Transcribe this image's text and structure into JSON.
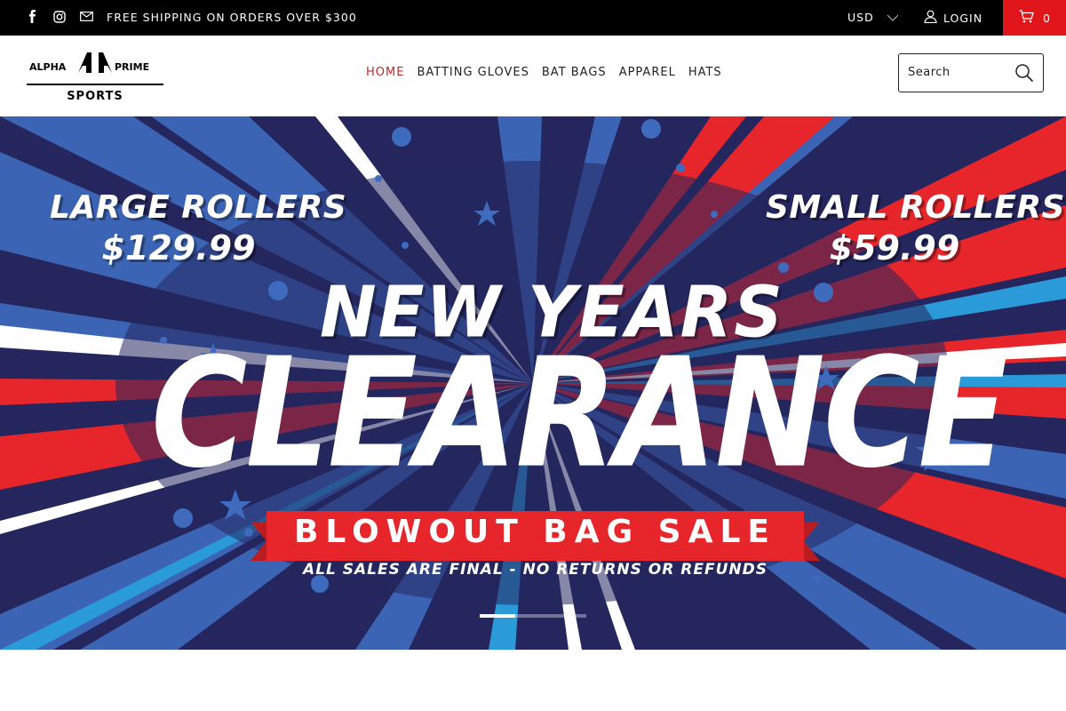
{
  "topbar": {
    "shipping_text": "FREE SHIPPING ON ORDERS OVER $300",
    "currency": "USD",
    "login_label": "LOGIN",
    "cart_count": "0",
    "social_icons": [
      "facebook-icon",
      "instagram-icon",
      "email-icon"
    ]
  },
  "header": {
    "logo": {
      "top_left": "ALPHA",
      "top_right": "PRIME",
      "bottom": "SPORTS"
    },
    "nav": [
      {
        "label": "HOME",
        "active": true
      },
      {
        "label": "BATTING GLOVES",
        "active": false
      },
      {
        "label": "BAT BAGS",
        "active": false
      },
      {
        "label": "APPAREL",
        "active": false
      },
      {
        "label": "HATS",
        "active": false
      }
    ],
    "search": {
      "placeholder": "Search",
      "value": ""
    }
  },
  "hero": {
    "left_title": "LARGE ROLLERS",
    "left_price": "$129.99",
    "right_title": "SMALL ROLLERS",
    "right_price": "$59.99",
    "headline_1": "NEW YEARS",
    "headline_2": "CLEARANCE",
    "ribbon": "BLOWOUT BAG SALE",
    "disclaimer": "ALL SALES ARE FINAL - NO RETURNS OR REFUNDS",
    "slide_index": 1,
    "slide_count": 3
  },
  "colors": {
    "topbar_bg": "#000000",
    "cart_bg": "#e0161b",
    "nav_active": "#c0282a",
    "hero_bg": "#25265e",
    "hero_red": "#e6262a",
    "hero_blue": "#3f6bbf"
  }
}
